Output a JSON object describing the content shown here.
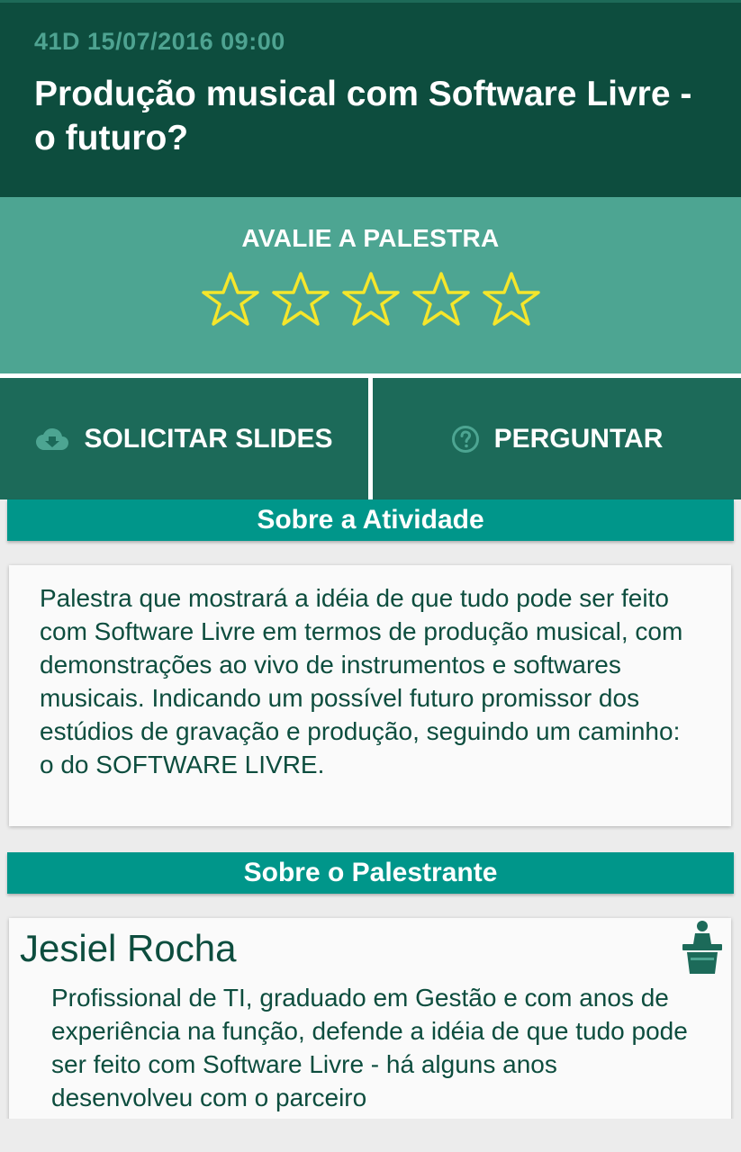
{
  "header": {
    "meta": "41D 15/07/2016 09:00",
    "title": "Produção musical com Software Livre - o futuro?"
  },
  "rating": {
    "label": "AVALIE A PALESTRA",
    "max_stars": 5,
    "value": 0,
    "star_color": "#f5e62b"
  },
  "actions": {
    "slides_label": "SOLICITAR SLIDES",
    "slides_icon": "cloud-download-icon",
    "ask_label": "PERGUNTAR",
    "ask_icon": "help-circle-icon"
  },
  "activity": {
    "section_title": "Sobre a Atividade",
    "description": "Palestra que mostrará a idéia de que tudo pode ser feito com Software Livre em termos de produção musical, com demonstrações ao vivo de instrumentos e softwares musicais. Indicando um possível futuro promissor dos estúdios de gravação e produção, seguindo um caminho: o do SOFTWARE LIVRE."
  },
  "speaker": {
    "section_title": "Sobre o Palestrante",
    "name": "Jesiel Rocha",
    "icon": "podium-speaker-icon",
    "bio": "Profissional de TI, graduado em Gestão e com anos de experiência na função, defende a idéia de que tudo pode ser feito com Software Livre - há alguns anos desenvolveu com o parceiro"
  },
  "colors": {
    "header_bg": "#0d4d3e",
    "rating_bg": "#4da592",
    "actions_bg": "#1c6a59",
    "section_bar": "#00968a",
    "text_dark": "#0d4d3e"
  }
}
